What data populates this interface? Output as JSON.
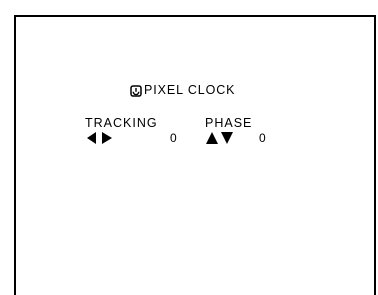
{
  "osd": {
    "title": "PIXEL CLOCK",
    "title_icon": "clock-icon",
    "tracking": {
      "label": "TRACKING",
      "value": "0",
      "control_icon": "left-right-arrows-icon"
    },
    "phase": {
      "label": "PHASE",
      "value": "0",
      "control_icon": "up-down-arrows-icon"
    }
  },
  "colors": {
    "background": "#ffffff",
    "foreground": "#000000"
  }
}
